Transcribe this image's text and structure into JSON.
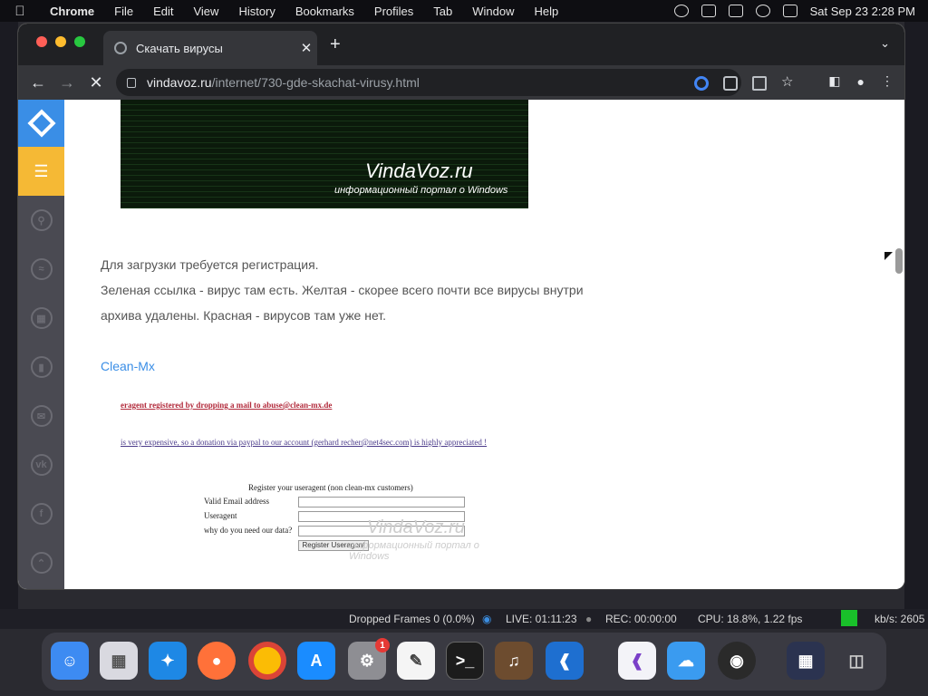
{
  "menubar": {
    "app": "Chrome",
    "items": [
      "File",
      "Edit",
      "View",
      "History",
      "Bookmarks",
      "Profiles",
      "Tab",
      "Window",
      "Help"
    ],
    "datetime": "Sat Sep 23  2:28 PM"
  },
  "browser": {
    "tab_title": "Скачать вирусы",
    "tab_close": "✕",
    "new_tab": "+",
    "url_host": "vindavoz.ru",
    "url_path": "/internet/730-gde-skachat-virusy.html"
  },
  "article": {
    "image_watermark_title": "VindaVoz.ru",
    "image_watermark_sub": "информационный портал о Windows",
    "para1": "Для загрузки требуется регистрация.",
    "para2": "Зеленая ссылка - вирус там есть. Желтая - скорее всего почти все вирусы внутри",
    "para3": "архива удалены. Красная - вирусов там уже нет.",
    "link": "Clean-Mx",
    "clean_mx": {
      "red_line": "eragent registered by dropping a mail to abuse@clean-mx.de",
      "purple_line": "is very expensive, so a donation via paypal to our account (gerhard recher@net4sec.com) is highly appreciated !",
      "form_title": "Register your useragent (non clean-mx customers)",
      "label_email": "Valid Email address",
      "label_useragent": "Useragent",
      "label_why": "why do you need our data?",
      "button": "Register Useragent",
      "watermark_title": "VindaVoz.ru",
      "watermark_sub": "информационный портал о Windows"
    }
  },
  "obs": {
    "dropped": "Dropped Frames 0 (0.0%)",
    "live": "LIVE: 01:11:23",
    "rec": "REC: 00:00:00",
    "cpu": "CPU: 18.8%, 1.22 fps",
    "kbs": "kb/s: 2605"
  },
  "dock": {
    "badge_count": "1",
    "apps": [
      "finder-icon",
      "launchpad-icon",
      "safari-icon",
      "firefox-icon",
      "chrome-icon",
      "app-store-icon",
      "system-settings-icon",
      "textedit-icon",
      "terminal-icon",
      "garageband-icon",
      "vscode-icon",
      "visual-studio-icon",
      "weather-icon",
      "obs-icon",
      "screenshot-icon",
      "trash-icon"
    ]
  }
}
